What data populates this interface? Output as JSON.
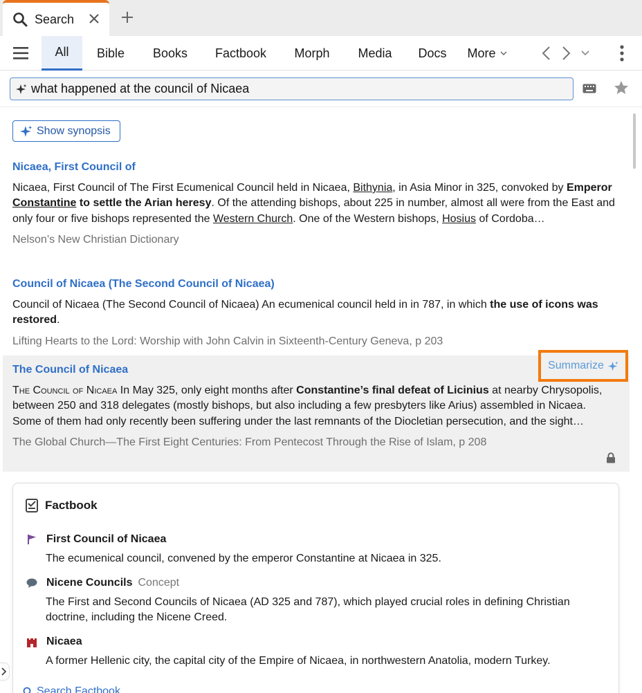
{
  "tab": {
    "title": "Search"
  },
  "nav": {
    "tabs": [
      {
        "label": "All"
      },
      {
        "label": "Bible"
      },
      {
        "label": "Books"
      },
      {
        "label": "Factbook"
      },
      {
        "label": "Morph"
      },
      {
        "label": "Media"
      },
      {
        "label": "Docs"
      },
      {
        "label": "More"
      }
    ]
  },
  "search": {
    "value": "what happened at the council of Nicaea"
  },
  "synopsis": {
    "label": "Show synopsis"
  },
  "results": [
    {
      "title": "Nicaea, First Council of",
      "body": [
        {
          "t": "Nicaea, First Council of The First Ecumenical Council held in Nicaea, "
        },
        {
          "t": "Bithynia",
          "u": true
        },
        {
          "t": ", in Asia Minor in 325, convoked by "
        },
        {
          "t": "Emperor ",
          "b": true
        },
        {
          "t": "Constantine",
          "b": true,
          "u": true
        },
        {
          "t": " to settle the Arian heresy",
          "b": true
        },
        {
          "t": ". Of the attending bishops, about 225 in number, almost all were from the East and only four or five bishops represented the "
        },
        {
          "t": "Western Church",
          "u": true
        },
        {
          "t": ". One of the Western bishops, "
        },
        {
          "t": "Hosius",
          "u": true
        },
        {
          "t": " of Cordoba…"
        }
      ],
      "source": "Nelson’s New Christian Dictionary"
    },
    {
      "title": "Council of Nicaea (The Second Council of Nicaea)",
      "body": [
        {
          "t": "Council of Nicaea (The Second Council of Nicaea) An ecumenical council held in in 787, in which "
        },
        {
          "t": "the use of icons was restored",
          "b": true
        },
        {
          "t": "."
        }
      ],
      "source": "Lifting Hearts to the Lord: Worship with John Calvin in Sixteenth-Century Geneva, p 203"
    },
    {
      "title": "The Council of Nicaea",
      "body": [
        {
          "t": "The Council of Nicaea",
          "sc": true
        },
        {
          "t": " In May 325, only eight months after "
        },
        {
          "t": "Constantine’s final defeat of Licinius",
          "b": true
        },
        {
          "t": " at nearby Chrysopolis, between 250 and 318 delegates (mostly bishops, but also including a few presbyters like Arius) assembled in Nicaea. Some of them had only recently been suffering under the last remnants of the Diocletian persecution, and the sight…"
        }
      ],
      "source": "The Global Church—The First Eight Centuries: From Pentecost Through the Rise of Islam, p 208"
    }
  ],
  "summarize": {
    "label": "Summarize"
  },
  "factbook": {
    "heading": "Factbook",
    "items": [
      {
        "title": "First Council of Nicaea",
        "type": "",
        "icon": "flag-icon",
        "description": "The ecumenical council, convened by the emperor Constantine at Nicaea in 325."
      },
      {
        "title": "Nicene Councils",
        "type": "Concept",
        "icon": "speech-bubble-icon",
        "description": "The First and Second Councils of Nicaea (AD 325 and 787), which played crucial roles in defining Christian doctrine, including the Nicene Creed."
      },
      {
        "title": "Nicaea",
        "type": "",
        "icon": "castle-icon",
        "description": "A former Hellenic city, the capital city of the Empire of Nicaea, in northwestern Anatolia, modern Turkey."
      }
    ],
    "search_link": "Search Factbook"
  },
  "colors": {
    "accent": "#2f6fc7",
    "highlight_border": "#f27a0e",
    "tab_accent": "#e8731c"
  }
}
